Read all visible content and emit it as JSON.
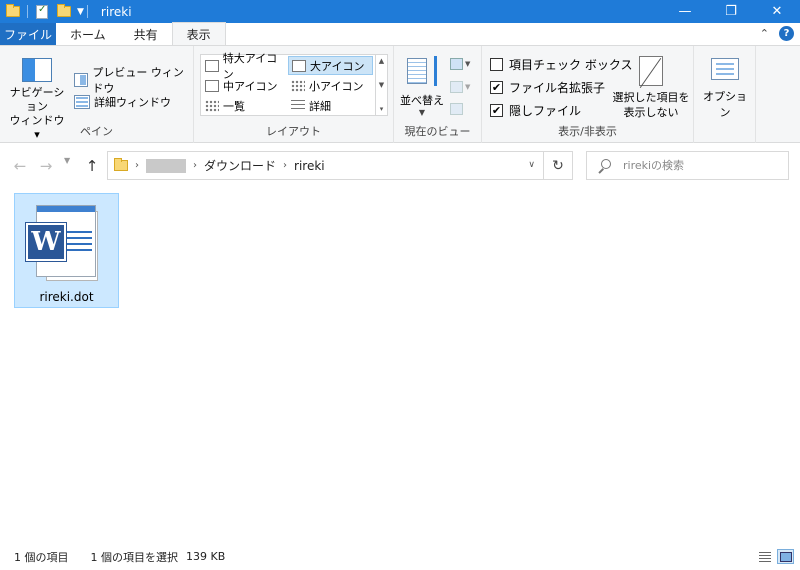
{
  "window": {
    "title": "rireki",
    "controls": {
      "minimize": "—",
      "maximize": "❐",
      "close": "✕"
    }
  },
  "ribbon_tabs": {
    "file": "ファイル",
    "items": [
      "ホーム",
      "共有",
      "表示"
    ],
    "active": "表示"
  },
  "ribbon": {
    "pane": {
      "label": "ペイン",
      "navigation_pane": "ナビゲーション\nウィンドウ ▾",
      "preview_pane": "プレビュー ウィンドウ",
      "details_pane": "詳細ウィンドウ"
    },
    "layout": {
      "label": "レイアウト",
      "items": [
        "特大アイコン",
        "大アイコン",
        "中アイコン",
        "小アイコン",
        "一覧",
        "詳細"
      ],
      "selected": "大アイコン"
    },
    "current_view": {
      "label": "現在のビュー",
      "sort_by": "並べ替え"
    },
    "show_hide": {
      "label": "表示/非表示",
      "item_checkboxes": {
        "label": "項目チェック ボックス",
        "checked": false
      },
      "file_extensions": {
        "label": "ファイル名拡張子",
        "checked": true
      },
      "hidden_items": {
        "label": "隠しファイル",
        "checked": true
      },
      "hide_selected": "選択した項目を\n表示しない"
    },
    "options": {
      "label": "オプション"
    }
  },
  "navigation": {
    "breadcrumb": [
      "ダウンロード",
      "rireki"
    ],
    "search_placeholder": "rirekiの検索"
  },
  "files": [
    {
      "name": "rireki.dot",
      "type": "word-template",
      "selected": true
    }
  ],
  "status_bar": {
    "item_count": "1 個の項目",
    "selected": "1 個の項目を選択",
    "size": "139 KB"
  }
}
